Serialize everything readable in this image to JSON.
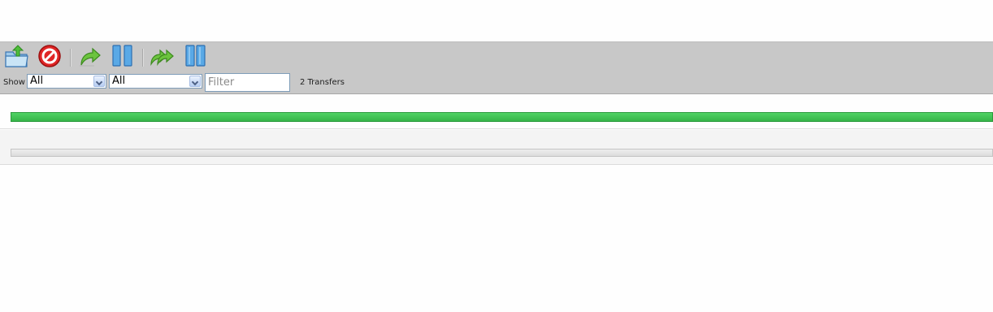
{
  "toolbar": {
    "buttons": [
      {
        "name": "add-transfer",
        "icon": "open-folder-upload-icon"
      },
      {
        "name": "remove-transfer",
        "icon": "no-entry-icon"
      },
      {
        "name": "resume-selected",
        "icon": "redo-arrow-icon"
      },
      {
        "name": "pause-selected",
        "icon": "pause-icon"
      },
      {
        "name": "resume-all",
        "icon": "double-redo-arrow-icon"
      },
      {
        "name": "pause-all",
        "icon": "pause-all-icon"
      }
    ]
  },
  "filterbar": {
    "show_label": "Show",
    "select_1": "All",
    "select_2": "All",
    "filter_placeholder": "Filter",
    "transfer_count": "2 Transfers"
  },
  "transfers": [
    {
      "progress": 1.0,
      "color": "#3cbf4f"
    },
    {
      "progress": 0.0,
      "color": "#dcdcdc"
    }
  ],
  "colors": {
    "toolbar_bg": "#c8c8c8",
    "accent_green": "#3cbf4f",
    "icon_blue": "#3d8fd6",
    "icon_red": "#d42020"
  }
}
